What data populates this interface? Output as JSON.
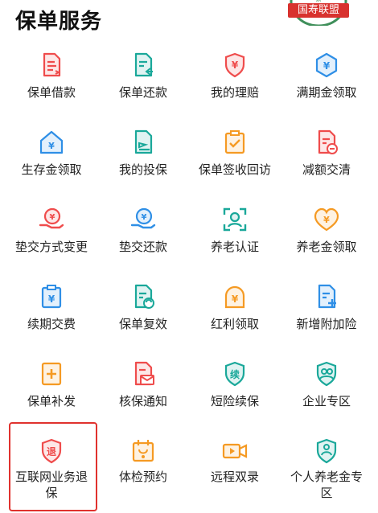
{
  "page": {
    "title": "保单服务"
  },
  "badge": {
    "text": "国寿联盟",
    "emblem": "紫"
  },
  "colors": {
    "red": "#ef4c4c",
    "teal": "#1aa89a",
    "blue": "#2f8fe6",
    "orange": "#f59a23",
    "highlight": "#e0322e"
  },
  "services": [
    {
      "label": "保单借款",
      "icon": "document-list-icon",
      "color": "red"
    },
    {
      "label": "保单还款",
      "icon": "document-return-icon",
      "color": "teal"
    },
    {
      "label": "我的理赔",
      "icon": "shield-yen-icon",
      "color": "red"
    },
    {
      "label": "满期金领取",
      "icon": "hexagon-yen-icon",
      "color": "blue"
    },
    {
      "label": "生存金领取",
      "icon": "house-yen-icon",
      "color": "blue"
    },
    {
      "label": "我的投保",
      "icon": "document-send-icon",
      "color": "teal"
    },
    {
      "label": "保单签收回访",
      "icon": "clipboard-check-icon",
      "color": "orange"
    },
    {
      "label": "减额交清",
      "icon": "document-minus-icon",
      "color": "red"
    },
    {
      "label": "垫交方式变更",
      "icon": "hand-yen-icon",
      "color": "red"
    },
    {
      "label": "垫交还款",
      "icon": "hand-coin-icon",
      "color": "blue"
    },
    {
      "label": "养老认证",
      "icon": "face-scan-icon",
      "color": "teal"
    },
    {
      "label": "养老金领取",
      "icon": "heart-yen-icon",
      "color": "orange"
    },
    {
      "label": "续期交费",
      "icon": "clipboard-yen-icon",
      "color": "blue"
    },
    {
      "label": "保单复效",
      "icon": "document-refresh-icon",
      "color": "teal"
    },
    {
      "label": "红利领取",
      "icon": "arch-yen-icon",
      "color": "orange"
    },
    {
      "label": "新增附加险",
      "icon": "document-plus-icon",
      "color": "blue"
    },
    {
      "label": "保单补发",
      "icon": "document-add-icon",
      "color": "orange"
    },
    {
      "label": "核保通知",
      "icon": "doc-envelope-icon",
      "color": "red"
    },
    {
      "label": "短险续保",
      "icon": "shield-renew-icon",
      "color": "teal"
    },
    {
      "label": "企业专区",
      "icon": "people-shield-icon",
      "color": "teal"
    },
    {
      "label": "互联网业务退保",
      "icon": "shield-withdraw-icon",
      "color": "red",
      "selected": true
    },
    {
      "label": "体检预约",
      "icon": "calendar-medical-icon",
      "color": "orange"
    },
    {
      "label": "远程双录",
      "icon": "video-record-icon",
      "color": "orange"
    },
    {
      "label": "个人养老金专区",
      "icon": "pension-shield-icon",
      "color": "teal"
    }
  ]
}
